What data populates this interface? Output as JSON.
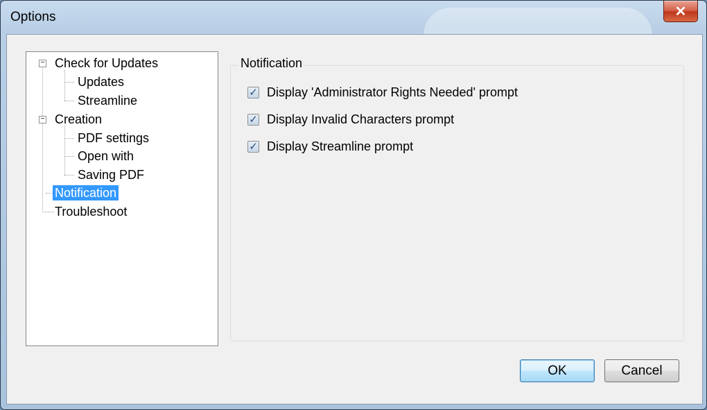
{
  "window": {
    "title": "Options",
    "close_glyph": "✕"
  },
  "tree": {
    "items": [
      {
        "label": "Check for Updates",
        "expander": "−"
      },
      {
        "label": "Updates"
      },
      {
        "label": "Streamline"
      },
      {
        "label": "Creation",
        "expander": "−"
      },
      {
        "label": "PDF settings"
      },
      {
        "label": "Open with"
      },
      {
        "label": "Saving PDF"
      },
      {
        "label": "Notification"
      },
      {
        "label": "Troubleshoot"
      }
    ],
    "selected": "Notification"
  },
  "panel": {
    "group_title": "Notification",
    "checkboxes": [
      {
        "label": "Display 'Administrator Rights Needed' prompt",
        "checked": true
      },
      {
        "label": "Display Invalid Characters prompt",
        "checked": true
      },
      {
        "label": "Display Streamline prompt",
        "checked": true
      }
    ],
    "check_glyph": "✓"
  },
  "buttons": {
    "ok": "OK",
    "cancel": "Cancel"
  },
  "colors": {
    "selection": "#3399ff",
    "close": "#c0381d"
  }
}
